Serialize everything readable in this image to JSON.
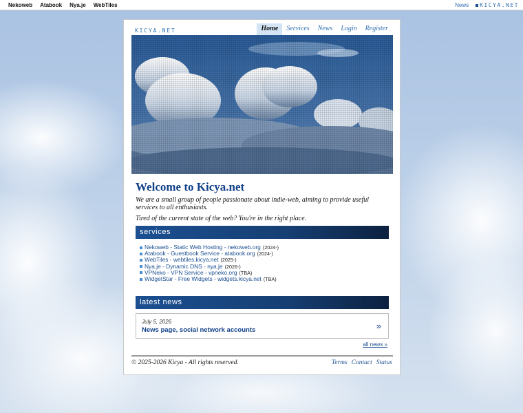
{
  "topbar": {
    "left_links": [
      "Nekoweb",
      "Atabook",
      "Nya.je",
      "WebTiles"
    ],
    "news_label": "News",
    "brand": "KICYA.NET"
  },
  "site": {
    "logo": "KICYA.NET",
    "nav": [
      {
        "label": "Home",
        "active": true
      },
      {
        "label": "Services",
        "active": false
      },
      {
        "label": "News",
        "active": false
      },
      {
        "label": "Login",
        "active": false
      },
      {
        "label": "Register",
        "active": false
      }
    ]
  },
  "main": {
    "title": "Welcome to Kicya.net",
    "intro": "We are a small group of people passionate about indie-web, aiming to provide useful services to all enthusiasts.",
    "intro2": "Tired of the current state of the web? You're in the right place."
  },
  "services": {
    "heading": "services",
    "items": [
      {
        "name": "Nekoweb - Static Web Hosting - nekoweb.org",
        "year": "(2024-)"
      },
      {
        "name": "Atabook - Guestbook Service - atabook.org",
        "year": "(2024-)"
      },
      {
        "name": "WebTiles - webtiles.kicya.net",
        "year": "(2025-)"
      },
      {
        "name": "Nya.je - Dynamic DNS - nya.je",
        "year": "(2026-)"
      },
      {
        "name": "VPNeko - VPN Service - vpneko.org",
        "year": "(TBA)"
      },
      {
        "name": "WidgetStar - Free Widgets - widgets.kicya.net",
        "year": "(TBA)"
      }
    ]
  },
  "news": {
    "heading": "latest news",
    "date": "July 5, 2026",
    "headline": "News page, social network accounts",
    "arrow": "»",
    "all_news": "all news »"
  },
  "footer": {
    "copyright": "© 2025-2026 Kicya - All rights reserved.",
    "links": [
      "Terms",
      "Contact",
      "Status"
    ]
  },
  "colors": {
    "accent": "#1b4f91",
    "title": "#12418a",
    "nav_active_bg": "#d3e4f5"
  }
}
